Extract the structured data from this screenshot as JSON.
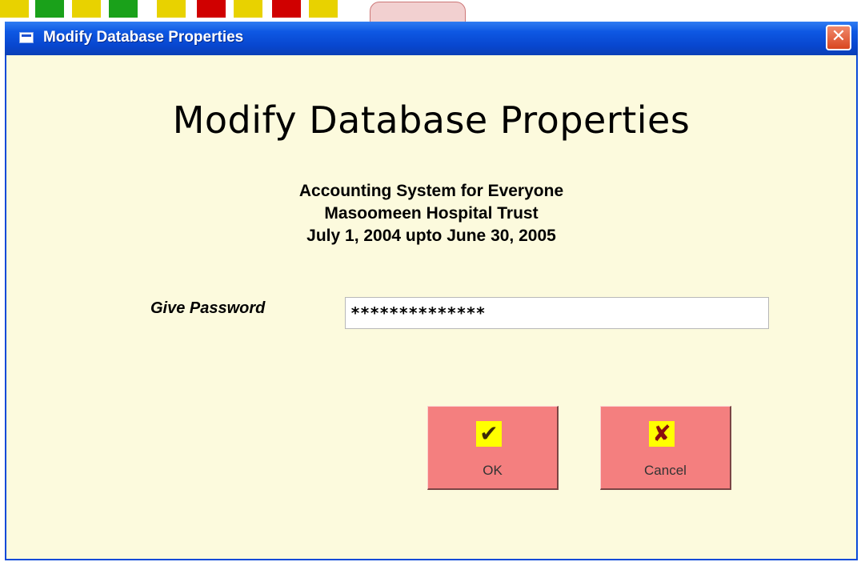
{
  "window": {
    "title": "Modify Database Properties",
    "close_symbol": "✕"
  },
  "content": {
    "heading": "Modify Database Properties",
    "subtitle_lines": [
      "Accounting System for Everyone",
      "Masoomeen Hospital Trust",
      "July 1, 2004 upto June 30, 2005"
    ]
  },
  "password": {
    "label": "Give Password",
    "value": "**************"
  },
  "buttons": {
    "ok_label": "OK",
    "cancel_label": "Cancel",
    "ok_icon": "check-icon",
    "cancel_icon": "x-mark-icon"
  },
  "colors": {
    "dialog_bg": "#fcfadd",
    "titlebar": "#0a4ad8",
    "button_bg": "#f47f7f",
    "icon_bg": "#ffff00"
  }
}
